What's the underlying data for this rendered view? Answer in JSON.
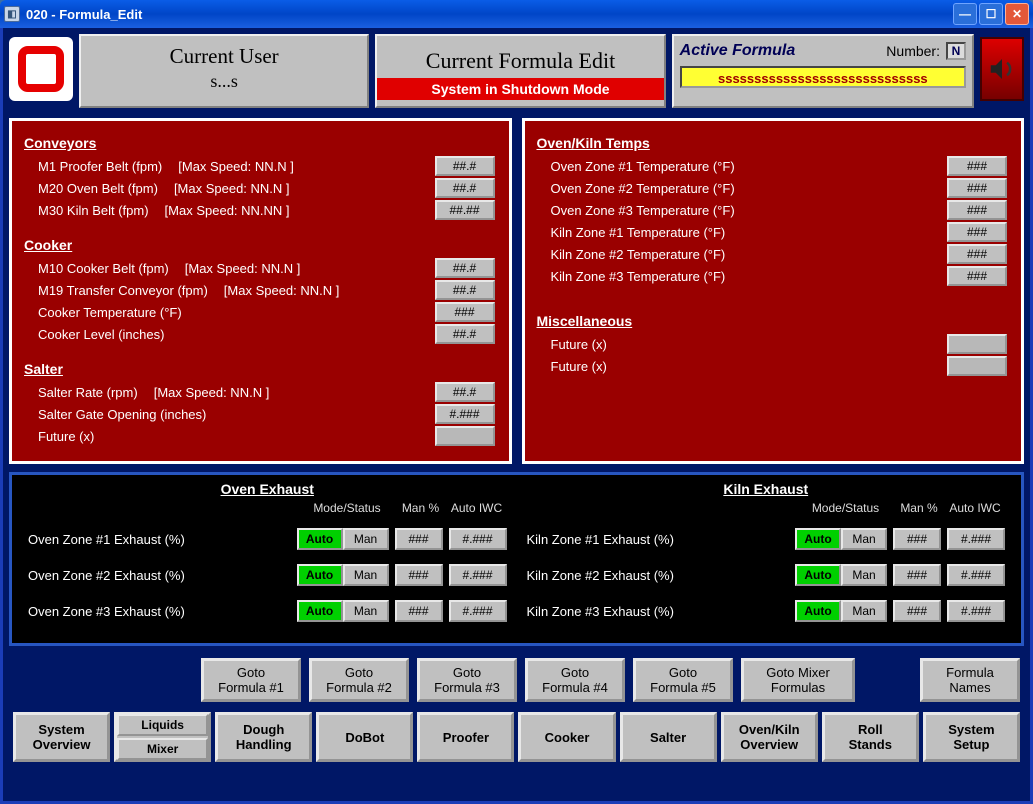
{
  "window": {
    "title": "020 - Formula_Edit"
  },
  "header": {
    "current_user_label": "Current User",
    "current_user_value": "s...s",
    "center_title": "Current Formula Edit",
    "shutdown": "System in Shutdown Mode",
    "active_formula_label": "Active Formula",
    "number_label": "Number:",
    "number_value": "N",
    "formula_name": "sssssssssssssssssssssssssssss"
  },
  "left_panel": {
    "conveyors": {
      "heading": "Conveyors",
      "rows": [
        {
          "label": "M1 Proofer Belt (fpm)",
          "note": "[Max Speed:  NN.N  ]",
          "val": "##.#"
        },
        {
          "label": "M20 Oven Belt (fpm)",
          "note": "[Max Speed:  NN.N  ]",
          "val": "##.#"
        },
        {
          "label": "M30 Kiln Belt (fpm)",
          "note": "[Max Speed:  NN.NN ]",
          "val": "##.##"
        }
      ]
    },
    "cooker": {
      "heading": "Cooker",
      "rows": [
        {
          "label": "M10 Cooker Belt (fpm)",
          "note": "[Max Speed:  NN.N  ]",
          "val": "##.#"
        },
        {
          "label": "M19 Transfer Conveyor (fpm)",
          "note": "[Max Speed:  NN.N  ]",
          "val": "##.#"
        },
        {
          "label": "Cooker Temperature (°F)",
          "note": "",
          "val": "###"
        },
        {
          "label": "Cooker Level (inches)",
          "note": "",
          "val": "##.#"
        }
      ]
    },
    "salter": {
      "heading": "Salter",
      "rows": [
        {
          "label": "Salter Rate (rpm)",
          "note": "[Max Speed:  NN.N  ]",
          "val": "##.#"
        },
        {
          "label": "Salter Gate Opening (inches)",
          "note": "",
          "val": "#.###"
        },
        {
          "label": "Future (x)",
          "note": "",
          "val": ""
        }
      ]
    }
  },
  "right_panel": {
    "temps": {
      "heading": "Oven/Kiln Temps",
      "rows": [
        {
          "label": "Oven Zone #1 Temperature (°F)",
          "val": "###"
        },
        {
          "label": "Oven Zone #2 Temperature (°F)",
          "val": "###"
        },
        {
          "label": "Oven Zone #3 Temperature (°F)",
          "val": "###"
        },
        {
          "label": "Kiln Zone #1 Temperature (°F)",
          "val": "###"
        },
        {
          "label": "Kiln Zone #2 Temperature (°F)",
          "val": "###"
        },
        {
          "label": "Kiln Zone #3 Temperature (°F)",
          "val": "###"
        }
      ]
    },
    "misc": {
      "heading": "Miscellaneous",
      "rows": [
        {
          "label": "Future (x)",
          "val": ""
        },
        {
          "label": "Future (x)",
          "val": ""
        }
      ]
    }
  },
  "exhaust": {
    "oven_title": "Oven Exhaust",
    "kiln_title": "Kiln Exhaust",
    "head_mode": "Mode/Status",
    "head_man": "Man %",
    "head_iwc": "Auto IWC",
    "auto_label": "Auto",
    "man_label": "Man",
    "oven_rows": [
      {
        "label": "Oven Zone #1 Exhaust (%)",
        "pct": "###",
        "iwc": "#.###"
      },
      {
        "label": "Oven Zone #2 Exhaust (%)",
        "pct": "###",
        "iwc": "#.###"
      },
      {
        "label": "Oven Zone #3 Exhaust (%)",
        "pct": "###",
        "iwc": "#.###"
      }
    ],
    "kiln_rows": [
      {
        "label": "Kiln Zone #1 Exhaust (%)",
        "pct": "###",
        "iwc": "#.###"
      },
      {
        "label": "Kiln Zone #2 Exhaust (%)",
        "pct": "###",
        "iwc": "#.###"
      },
      {
        "label": "Kiln Zone #3 Exhaust (%)",
        "pct": "###",
        "iwc": "#.###"
      }
    ]
  },
  "goto": {
    "items": [
      "Goto\nFormula #1",
      "Goto\nFormula #2",
      "Goto\nFormula #3",
      "Goto\nFormula #4",
      "Goto\nFormula #5",
      "Goto Mixer\nFormulas"
    ],
    "right": "Formula\nNames"
  },
  "nav": {
    "system_overview": "System\nOverview",
    "liquids": "Liquids",
    "mixer": "Mixer",
    "dough": "Dough\nHandling",
    "dobot": "DoBot",
    "proofer": "Proofer",
    "cooker": "Cooker",
    "salter": "Salter",
    "ovenkiln": "Oven/Kiln\nOverview",
    "rollstands": "Roll\nStands",
    "setup": "System\nSetup"
  }
}
